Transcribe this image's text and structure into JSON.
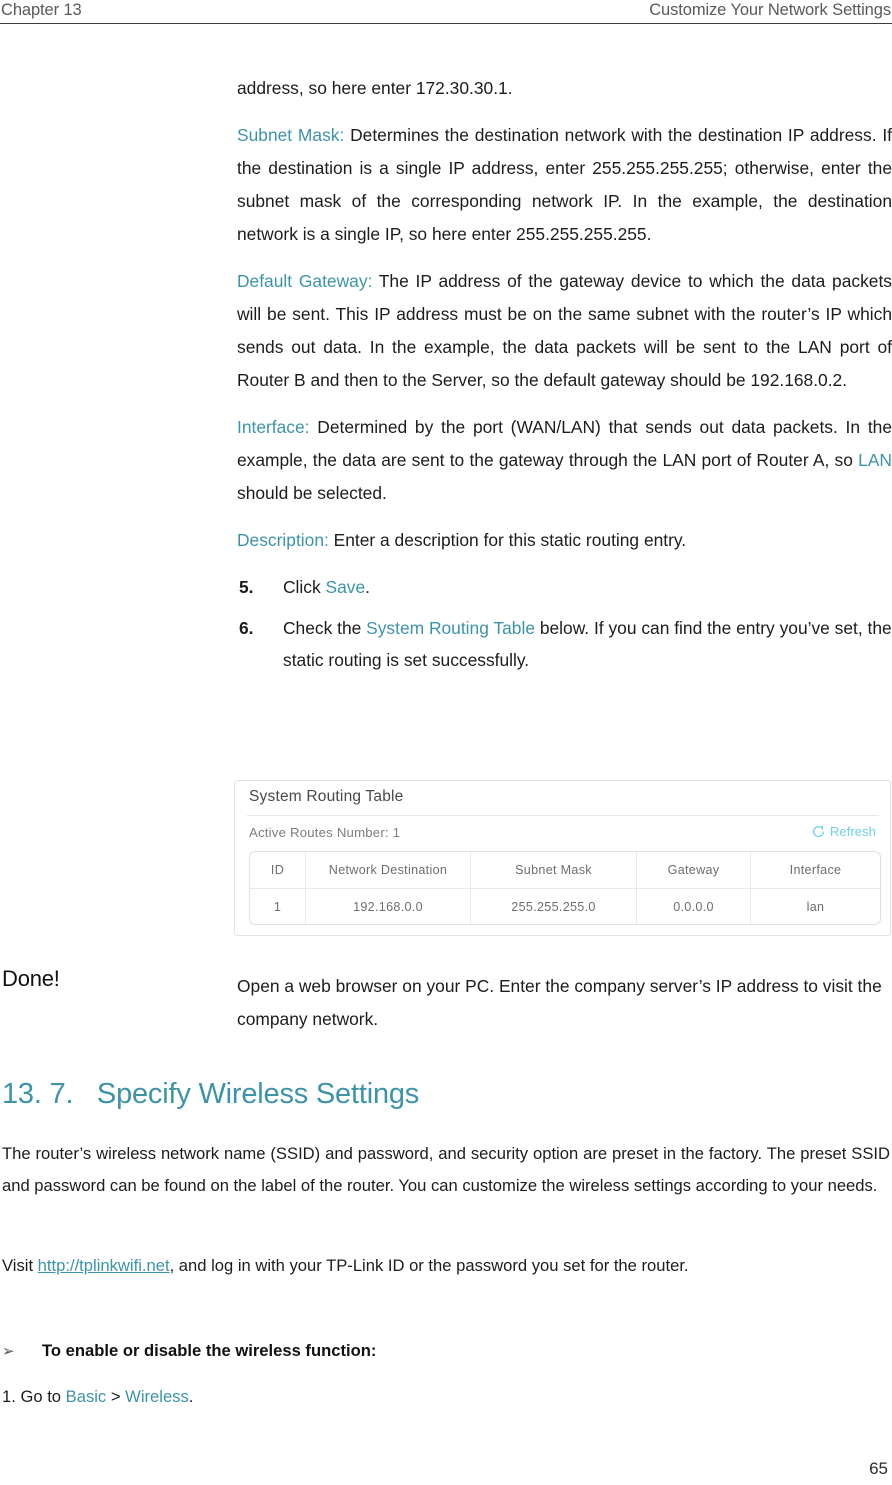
{
  "header": {
    "left": "Chapter 13",
    "right": "Customize Your Network Settings"
  },
  "body": {
    "para_address": {
      "text": "address, so here enter 172.30.30.1."
    },
    "para_subnet": {
      "label": "Subnet Mask:",
      "text": " Determines the destination network with the destination IP address. If the destination is a single IP address, enter 255.255.255.255; otherwise, enter the subnet mask of the corresponding network IP. In the example, the destination network is a single IP, so here enter 255.255.255.255."
    },
    "para_gateway": {
      "label": "Default Gateway:",
      "text": " The IP address of the gateway device to which the data packets will be sent. This IP address must be on the same subnet with the router’s IP which sends out data. In the example, the data packets will be sent to the LAN port of Router B and then to the Server, so the default gateway should be 192.168.0.2."
    },
    "para_interface": {
      "label": "Interface:",
      "text_before": " Determined by the port (WAN/LAN) that sends out data packets. In the example, the data are sent to the gateway through the LAN port of Router A, so ",
      "highlight": "LAN",
      "text_after": " should be selected."
    },
    "para_description": {
      "label": "Description:",
      "text": " Enter a description for this static routing entry."
    },
    "step5": {
      "number": "5.",
      "text_before": "Click ",
      "highlight": "Save",
      "text_after": "."
    },
    "step6": {
      "number": "6.",
      "text_before": "Check the ",
      "highlight": "System Routing Table",
      "text_after": " below. If you can find the entry you’ve set, the static routing is set successfully."
    }
  },
  "routing_panel": {
    "title": "System Routing Table",
    "active_routes_label": "Active Routes Number:  1",
    "refresh_label": "Refresh",
    "refresh_icon": "refresh-circular-arrow-icon",
    "accent_color": "#6fd2e2",
    "columns": [
      "ID",
      "Network Destination",
      "Subnet Mask",
      "Gateway",
      "Interface"
    ],
    "rows": [
      [
        "1",
        "192.168.0.0",
        "255.255.255.0",
        "0.0.0.0",
        "lan"
      ]
    ]
  },
  "done_block": {
    "label": "Done!",
    "text": "Open a web browser on your PC. Enter the company server’s IP address to visit the company network."
  },
  "section": {
    "heading": "13. 7.   Specify Wireless Settings",
    "heading_color": "#3d93a8",
    "paragraph1": "The router’s wireless network name (SSID) and password, and security option are preset in the factory. The preset SSID and password can be found on the label of the router. You can customize the wireless settings according to your needs.",
    "paragraph2": {
      "before": "Visit ",
      "link": "http://tplinkwifi.net",
      "after": ", and log in with your TP-Link ID or the password you set for the router."
    },
    "arrow_bullet": {
      "glyph": "➢",
      "text": "To enable or disable the wireless function:"
    },
    "numbered_line": {
      "before": "1. Go to ",
      "link1": "Basic",
      "middle": " > ",
      "link2": "Wireless",
      "after": "."
    }
  },
  "footer": {
    "page_number": "65"
  }
}
